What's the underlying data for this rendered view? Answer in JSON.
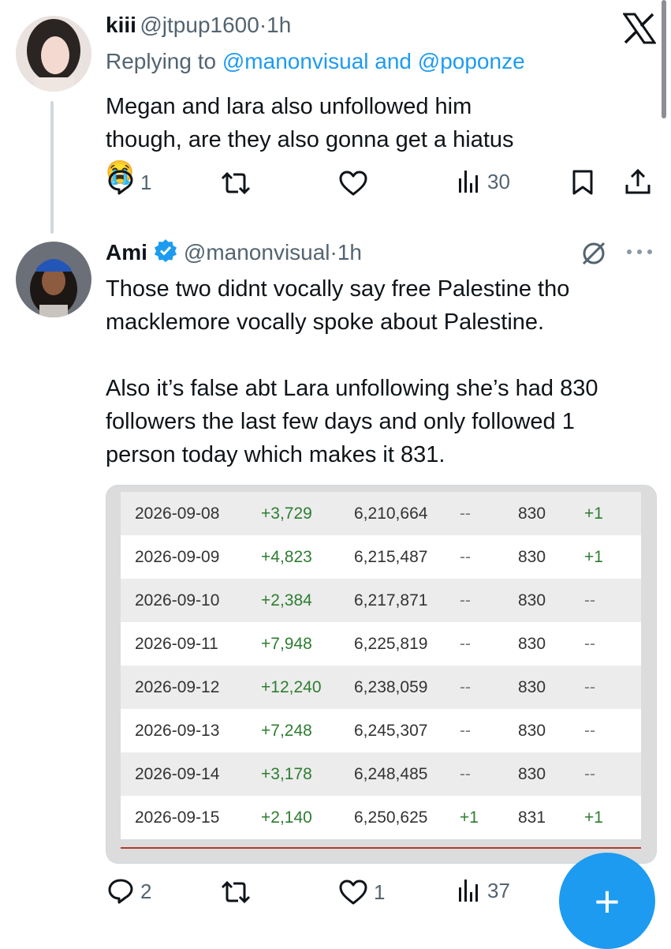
{
  "app": {
    "logo_icon": "x-logo-icon"
  },
  "tweet1": {
    "name": "kiii",
    "handle": "@jtpup1600",
    "sep": "·",
    "time": "1h",
    "replying_prefix": "Replying to ",
    "reply_user1": "@manonvisual",
    "reply_and": " and ",
    "reply_user2": "@poponze",
    "text": "Megan and lara also unfollowed him though, are they also gonna get a hiatus 😭",
    "replies": "1",
    "reposts": "",
    "likes": "",
    "views": "30"
  },
  "tweet2": {
    "name": "Ami",
    "verified": true,
    "handle": "@manonvisual",
    "sep": "·",
    "time": "1h",
    "text": "Those two didnt vocally say free Palestine tho macklemore vocally spoke about Palestine.\n\nAlso it’s false abt Lara unfollowing she’s had 830 followers the last few days and only followed 1 person today which makes it 831.",
    "replies": "2",
    "reposts": "",
    "likes": "1",
    "views": "37"
  },
  "table": {
    "rows": [
      [
        "2026-09-08",
        "+3,729",
        "6,210,664",
        "--",
        "830",
        "+1"
      ],
      [
        "2026-09-09",
        "+4,823",
        "6,215,487",
        "--",
        "830",
        "+1"
      ],
      [
        "2026-09-10",
        "+2,384",
        "6,217,871",
        "--",
        "830",
        "--"
      ],
      [
        "2026-09-11",
        "+7,948",
        "6,225,819",
        "--",
        "830",
        "--"
      ],
      [
        "2026-09-12",
        "+12,240",
        "6,238,059",
        "--",
        "830",
        "--"
      ],
      [
        "2026-09-13",
        "+7,248",
        "6,245,307",
        "--",
        "830",
        "--"
      ],
      [
        "2026-09-14",
        "+3,178",
        "6,248,485",
        "--",
        "830",
        "--"
      ],
      [
        "2026-09-15",
        "+2,140",
        "6,250,625",
        "+1",
        "831",
        "+1"
      ]
    ]
  },
  "fab": {
    "label": "+"
  },
  "colors": {
    "accent": "#1d9bf0",
    "green": "#2e7d32",
    "muted": "#536471"
  }
}
